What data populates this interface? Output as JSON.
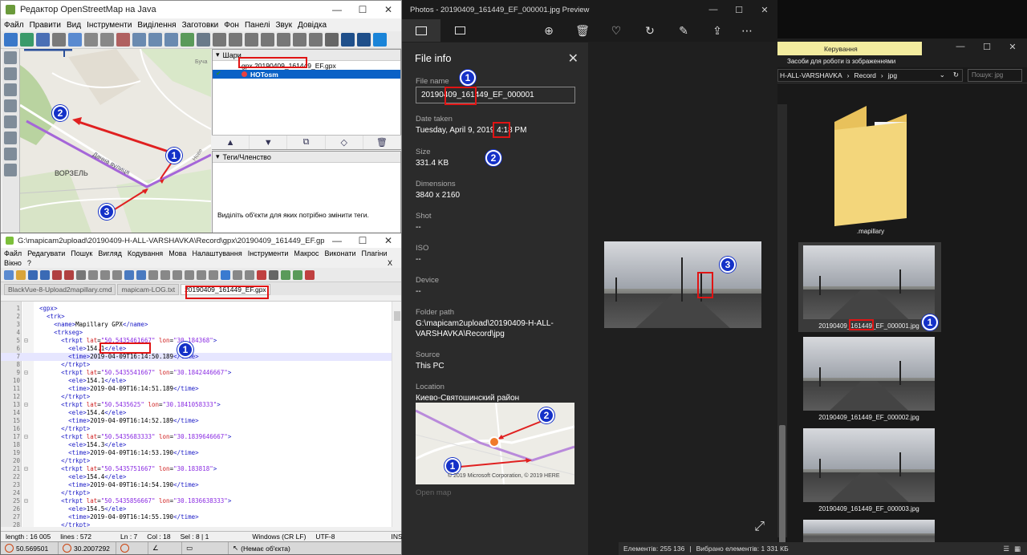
{
  "josm": {
    "title": "Редактор OpenStreetMap на Java",
    "menu": [
      "Файл",
      "Правити",
      "Вид",
      "Інструменти",
      "Виділення",
      "Заготовки",
      "Фон",
      "Панелі",
      "Звук",
      "Довідка"
    ],
    "map_labels": {
      "town": "ВОРЗЕЛЬ",
      "street": "Дачна вулиця",
      "bucha": "Буча",
      "nove": "Нове"
    },
    "layers_title": "Шари",
    "layers": [
      {
        "name": "gpx 20190409_161449_EF.gpx",
        "selected": false
      },
      {
        "name": "HOTosm",
        "selected": true
      }
    ],
    "tags_title": "Теги/Членство",
    "tags_hint": "Виділіть об'єкти для яких потрібно змінити теги.",
    "status": {
      "lat": "50.569501",
      "lon": "30.2007292",
      "selection": "(Немає об'єкта)"
    }
  },
  "npp": {
    "title": "G:\\mapicam2upload\\20190409-H-ALL-VARSHAVKA\\Record\\gpx\\20190409_161449_EF.gpx - Notepad++",
    "menu1": [
      "Файл",
      "Редагувати",
      "Пошук",
      "Вигляд",
      "Кодування",
      "Мова",
      "Налаштування",
      "Інструменти",
      "Макрос",
      "Виконати",
      "Плагіни"
    ],
    "menu2": [
      "Вікно",
      "?"
    ],
    "close_x": "X",
    "tabs": [
      "BlackVue-8-Upload2mapillary.cmd",
      "mapicam-LOG.txt",
      "20190409_161449_EF.gpx"
    ],
    "lines": [
      {
        "n": "1",
        "t": "<gpx>"
      },
      {
        "n": "2",
        "t": "  <trk>"
      },
      {
        "n": "3",
        "t": "    <name>Mapillary GPX</name>"
      },
      {
        "n": "4",
        "t": "    <trkseg>"
      },
      {
        "n": "5",
        "t": "      <trkpt lat=\"50.5435461667\" lon=\"30.184368\">"
      },
      {
        "n": "6",
        "t": "        <ele>154.1</ele>"
      },
      {
        "n": "7",
        "t": "        <time>2019-04-09T16:14:50.189</time>"
      },
      {
        "n": "8",
        "t": "      </trkpt>"
      },
      {
        "n": "9",
        "t": "      <trkpt lat=\"50.5435541667\" lon=\"30.1842446667\">"
      },
      {
        "n": "10",
        "t": "        <ele>154.1</ele>"
      },
      {
        "n": "11",
        "t": "        <time>2019-04-09T16:14:51.189</time>"
      },
      {
        "n": "12",
        "t": "      </trkpt>"
      },
      {
        "n": "13",
        "t": "      <trkpt lat=\"50.5435625\" lon=\"30.1841058333\">"
      },
      {
        "n": "14",
        "t": "        <ele>154.4</ele>"
      },
      {
        "n": "15",
        "t": "        <time>2019-04-09T16:14:52.189</time>"
      },
      {
        "n": "16",
        "t": "      </trkpt>"
      },
      {
        "n": "17",
        "t": "      <trkpt lat=\"50.5435683333\" lon=\"30.1839646667\">"
      },
      {
        "n": "18",
        "t": "        <ele>154.3</ele>"
      },
      {
        "n": "19",
        "t": "        <time>2019-04-09T16:14:53.190</time>"
      },
      {
        "n": "20",
        "t": "      </trkpt>"
      },
      {
        "n": "21",
        "t": "      <trkpt lat=\"50.5435751667\" lon=\"30.183818\">"
      },
      {
        "n": "22",
        "t": "        <ele>154.4</ele>"
      },
      {
        "n": "23",
        "t": "        <time>2019-04-09T16:14:54.190</time>"
      },
      {
        "n": "24",
        "t": "      </trkpt>"
      },
      {
        "n": "25",
        "t": "      <trkpt lat=\"50.5435856667\" lon=\"30.1836638333\">"
      },
      {
        "n": "26",
        "t": "        <ele>154.5</ele>"
      },
      {
        "n": "27",
        "t": "        <time>2019-04-09T16:14:55.190</time>"
      },
      {
        "n": "28",
        "t": "      </trkpt>"
      }
    ],
    "status": {
      "length": "length : 16 005",
      "lines": "lines : 572",
      "ln": "Ln : 7",
      "col": "Col : 18",
      "sel": "Sel : 8 | 1",
      "eol": "Windows (CR LF)",
      "enc": "UTF-8",
      "ins": "INS"
    }
  },
  "photos": {
    "title": "Photos - 20190409_161449_EF_000001.jpg Preview",
    "info_title": "File info",
    "file_name_label": "File name",
    "file_name": "20190409_161449_EF_000001",
    "date_label": "Date taken",
    "date": "Tuesday, April 9, 2019 4:18 PM",
    "size_label": "Size",
    "size": "331.4 KB",
    "dim_label": "Dimensions",
    "dim": "3840 x 2160",
    "shot_label": "Shot",
    "shot": "--",
    "iso_label": "ISO",
    "iso": "--",
    "device_label": "Device",
    "device": "--",
    "folder_label": "Folder path",
    "folder1": "G:\\mapicam2upload\\20190409-H-ALL-",
    "folder2": "VARSHAVKA\\Record\\jpg",
    "source_label": "Source",
    "source": "This PC",
    "location_label": "Location",
    "location": "Киево-Святошинский район",
    "map_credit": "© 2019 Microsoft Corporation, © 2019 HERE",
    "open_map": "Open map"
  },
  "explorer": {
    "ribbon": "Керування",
    "subribbon": "Засоби для роботи із зображеннями",
    "path": [
      "H-ALL-VARSHAVKA",
      "Record",
      "jpg"
    ],
    "search_placeholder": "Пошук: jpg",
    "folder": ".mapillary",
    "files": [
      "20190409_161449_EF_000001.jpg",
      "20190409_161449_EF_000002.jpg",
      "20190409_161449_EF_000003.jpg"
    ],
    "status_elements": "Елементів: 255 136",
    "status_selected": "Вибрано елементів: 1  331 КБ"
  },
  "callouts": [
    "1",
    "2",
    "3"
  ]
}
